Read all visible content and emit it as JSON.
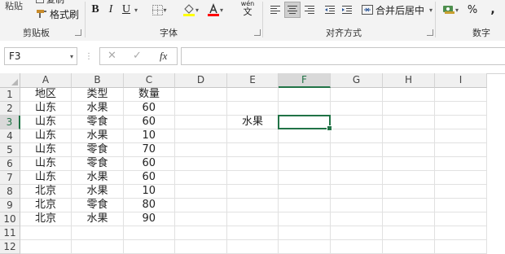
{
  "ribbon": {
    "paste_label": "粘贴",
    "copy_label": "复制",
    "format_painter_label": "格式刷",
    "bold_label": "B",
    "italic_label": "I",
    "underline_label": "U",
    "phonetic_label": "wén",
    "phonetic_char": "文",
    "merge_label": "合并后居中",
    "percent_label": "%",
    "comma_label": ",",
    "groups": {
      "clipboard": "剪贴板",
      "font": "字体",
      "alignment": "对齐方式",
      "number": "数字"
    },
    "colors": {
      "fill": "#ffff00",
      "font": "#ff0000",
      "accent": "#217346"
    }
  },
  "formula_bar": {
    "name_box": "F3",
    "cancel_icon": "✕",
    "enter_icon": "✓",
    "fx_label": "fx",
    "formula": ""
  },
  "sheet": {
    "columns": [
      "A",
      "B",
      "C",
      "D",
      "E",
      "F",
      "G",
      "H",
      "I"
    ],
    "rows": [
      "1",
      "2",
      "3",
      "4",
      "5",
      "6",
      "7",
      "8",
      "9",
      "10",
      "11",
      "12"
    ],
    "active_cell": "F3",
    "cells": {
      "A1": "地区",
      "B1": "类型",
      "C1": "数量",
      "A2": "山东",
      "B2": "水果",
      "C2": "60",
      "A3": "山东",
      "B3": "零食",
      "C3": "60",
      "E3": "水果",
      "A4": "山东",
      "B4": "水果",
      "C4": "10",
      "A5": "山东",
      "B5": "零食",
      "C5": "70",
      "A6": "山东",
      "B6": "零食",
      "C6": "60",
      "A7": "山东",
      "B7": "水果",
      "C7": "60",
      "A8": "北京",
      "B8": "水果",
      "C8": "10",
      "A9": "北京",
      "B9": "零食",
      "C9": "80",
      "A10": "北京",
      "B10": "水果",
      "C10": "90"
    }
  }
}
